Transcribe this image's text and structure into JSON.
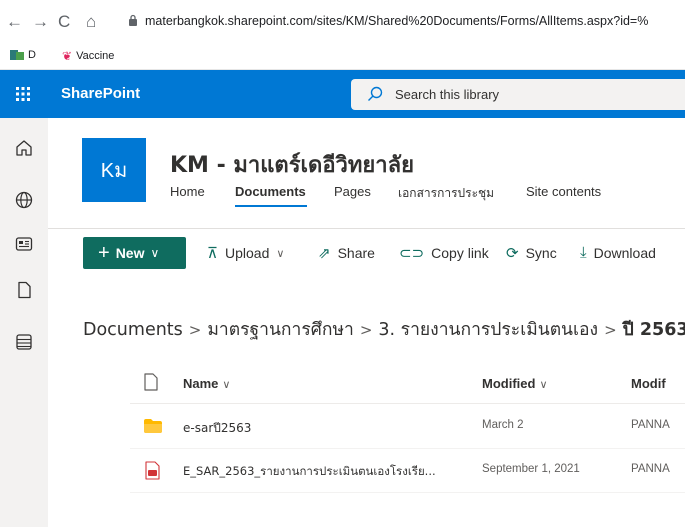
{
  "browser": {
    "url": "materbangkok.sharepoint.com/sites/KM/Shared%20Documents/Forms/AllItems.aspx?id=%",
    "bookmarks": [
      {
        "label": "D"
      },
      {
        "label": "Vaccine"
      }
    ]
  },
  "suitebar": {
    "app_name": "SharePoint",
    "search_placeholder": "Search this library"
  },
  "site": {
    "logo_text": "Kม",
    "title": "KM - มาแตร์เดอีวิทยาลัย",
    "nav": [
      "Home",
      "Documents",
      "Pages",
      "เอกสารการประชุม",
      "Site contents"
    ],
    "active_nav": "Documents"
  },
  "commands": {
    "new_label": "New",
    "upload_label": "Upload",
    "share_label": "Share",
    "copy_link_label": "Copy link",
    "sync_label": "Sync",
    "download_label": "Download"
  },
  "breadcrumb": [
    "Documents",
    "มาตรฐานการศึกษา",
    "3. รายงานการประเมินตนเอง",
    "ปี 2563"
  ],
  "list": {
    "columns": [
      "Name",
      "Modified",
      "Modif"
    ],
    "rows": [
      {
        "name": "e-sarปี2563",
        "modified": "March 2",
        "modified_by": "PANNA",
        "type": "folder"
      },
      {
        "name": "E_SAR_2563_รายงานการประเมินตนเองโรงเรีย...",
        "modified": "September 1, 2021",
        "modified_by": "PANNA",
        "type": "pdf"
      }
    ]
  },
  "colors": {
    "brand": "#0078d4",
    "new_button": "#0f6c5f",
    "folder": "#ffb900",
    "pdf": "#d13438"
  }
}
